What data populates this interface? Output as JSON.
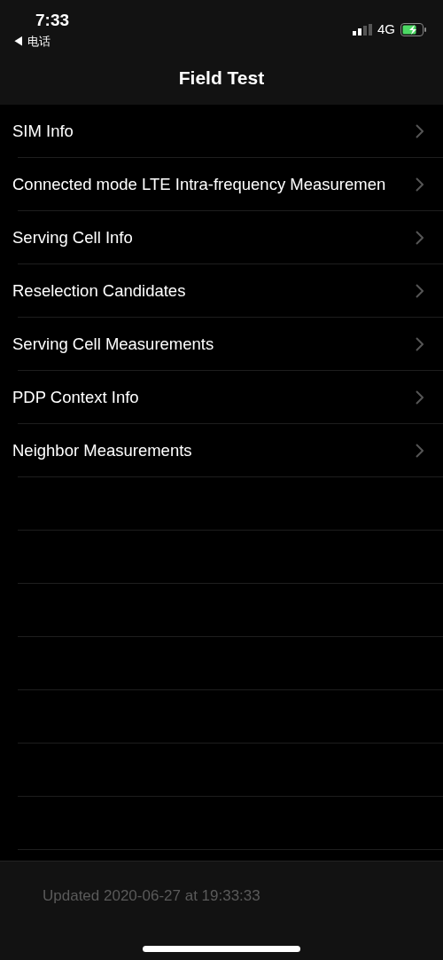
{
  "status_bar": {
    "time": "7:33",
    "back_app": "◀ 电话",
    "network": "4G",
    "battery_charging": true
  },
  "nav": {
    "title": "Field Test"
  },
  "items": [
    {
      "label": "SIM Info"
    },
    {
      "label": "Connected mode LTE Intra-frequency Measuremen"
    },
    {
      "label": "Serving Cell Info"
    },
    {
      "label": "Reselection Candidates"
    },
    {
      "label": "Serving Cell Measurements"
    },
    {
      "label": "PDP Context Info"
    },
    {
      "label": "Neighbor Measurements"
    }
  ],
  "footer": {
    "updated": "Updated 2020-06-27 at 19:33:33"
  }
}
